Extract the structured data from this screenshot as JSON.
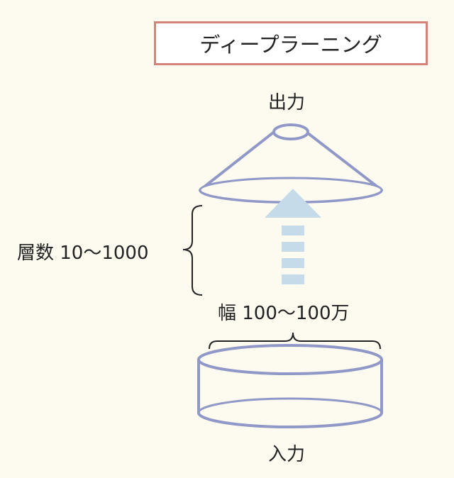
{
  "title": "ディープラーニング",
  "output_label": "出力",
  "input_label": "入力",
  "layers_label": "層数 10〜1000",
  "width_label": "幅 100〜100万",
  "colors": {
    "background": "#fdfbef",
    "title_border": "#d4827a",
    "shape_stroke": "#9098c8",
    "shape_fill": "#fdfbef",
    "arrow": "#c5dbe9",
    "bracket": "#222222"
  }
}
